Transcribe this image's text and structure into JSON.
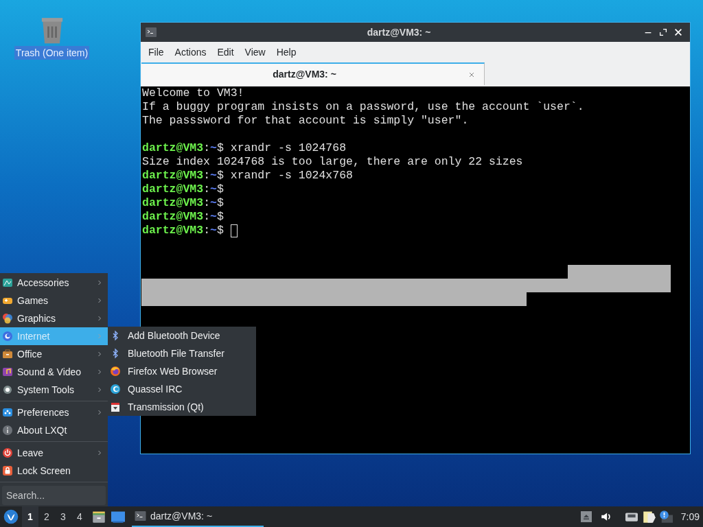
{
  "desktop_icons": [
    {
      "label": "Trash (One item)",
      "selected": true
    }
  ],
  "terminal": {
    "title": "dartz@VM3: ~",
    "menu": [
      "File",
      "Actions",
      "Edit",
      "View",
      "Help"
    ],
    "tabs": [
      {
        "label": "dartz@VM3: ~",
        "selected": true
      }
    ],
    "lines": [
      {
        "kind": "output",
        "text": "Welcome to VM3!"
      },
      {
        "kind": "output",
        "text": "If a buggy program insists on a password, use the account `user`."
      },
      {
        "kind": "output",
        "text": "The passsword for that account is simply \"user\"."
      },
      {
        "kind": "blank"
      },
      {
        "kind": "prompt",
        "user_host": "dartz@VM3",
        "sep": ":",
        "path": "~",
        "symbol": "$",
        "command": " xrandr -s 1024768",
        "cursor": false
      },
      {
        "kind": "output",
        "text": "Size index 1024768 is too large, there are only 22 sizes"
      },
      {
        "kind": "prompt",
        "user_host": "dartz@VM3",
        "sep": ":",
        "path": "~",
        "symbol": "$",
        "command": " xrandr -s 1024x768",
        "cursor": false
      },
      {
        "kind": "prompt",
        "user_host": "dartz@VM3",
        "sep": ":",
        "path": "~",
        "symbol": "$",
        "cursor": false
      },
      {
        "kind": "prompt",
        "user_host": "dartz@VM3",
        "sep": ":",
        "path": "~",
        "symbol": "$",
        "cursor": false
      },
      {
        "kind": "prompt",
        "user_host": "dartz@VM3",
        "sep": ":",
        "path": "~",
        "symbol": "$",
        "cursor": false
      },
      {
        "kind": "prompt",
        "user_host": "dartz@VM3",
        "sep": ":",
        "path": "~",
        "symbol": "$",
        "cursor": true
      }
    ]
  },
  "start_menu": {
    "sections": [
      [
        {
          "label": "Accessories",
          "kind": "accessories",
          "submenu": true,
          "selected": false
        },
        {
          "label": "Games",
          "kind": "games",
          "submenu": true,
          "selected": false
        },
        {
          "label": "Graphics",
          "kind": "graphics",
          "submenu": true,
          "selected": false
        },
        {
          "label": "Internet",
          "kind": "internet",
          "submenu": true,
          "selected": true
        },
        {
          "label": "Office",
          "kind": "office",
          "submenu": true,
          "selected": false
        },
        {
          "label": "Sound & Video",
          "kind": "sound",
          "submenu": true,
          "selected": false
        },
        {
          "label": "System Tools",
          "kind": "tools",
          "submenu": true,
          "selected": false
        }
      ],
      [
        {
          "label": "Preferences",
          "kind": "prefs",
          "submenu": true,
          "selected": false
        },
        {
          "label": "About LXQt",
          "kind": "about",
          "submenu": false,
          "selected": false
        }
      ],
      [
        {
          "label": "Leave",
          "kind": "leave",
          "submenu": true,
          "selected": false
        },
        {
          "label": "Lock Screen",
          "kind": "lock",
          "submenu": false,
          "selected": false
        }
      ]
    ],
    "search": {
      "placeholder": "Search..."
    }
  },
  "submenu": [
    {
      "label": "Add Bluetooth Device",
      "kind": "bluetooth"
    },
    {
      "label": "Bluetooth File Transfer",
      "kind": "bluetooth"
    },
    {
      "label": "Firefox Web Browser",
      "kind": "firefox"
    },
    {
      "label": "Quassel IRC",
      "kind": "quassel"
    },
    {
      "label": "Transmission (Qt)",
      "kind": "transmission"
    }
  ],
  "taskbar": {
    "workspaces": [
      {
        "label": "1",
        "selected": true
      },
      {
        "label": "2",
        "selected": false
      },
      {
        "label": "3",
        "selected": false
      },
      {
        "label": "4",
        "selected": false
      }
    ],
    "tasks": [
      {
        "label": "dartz@VM3: ~",
        "selected": true
      }
    ],
    "clock": "7:09"
  }
}
